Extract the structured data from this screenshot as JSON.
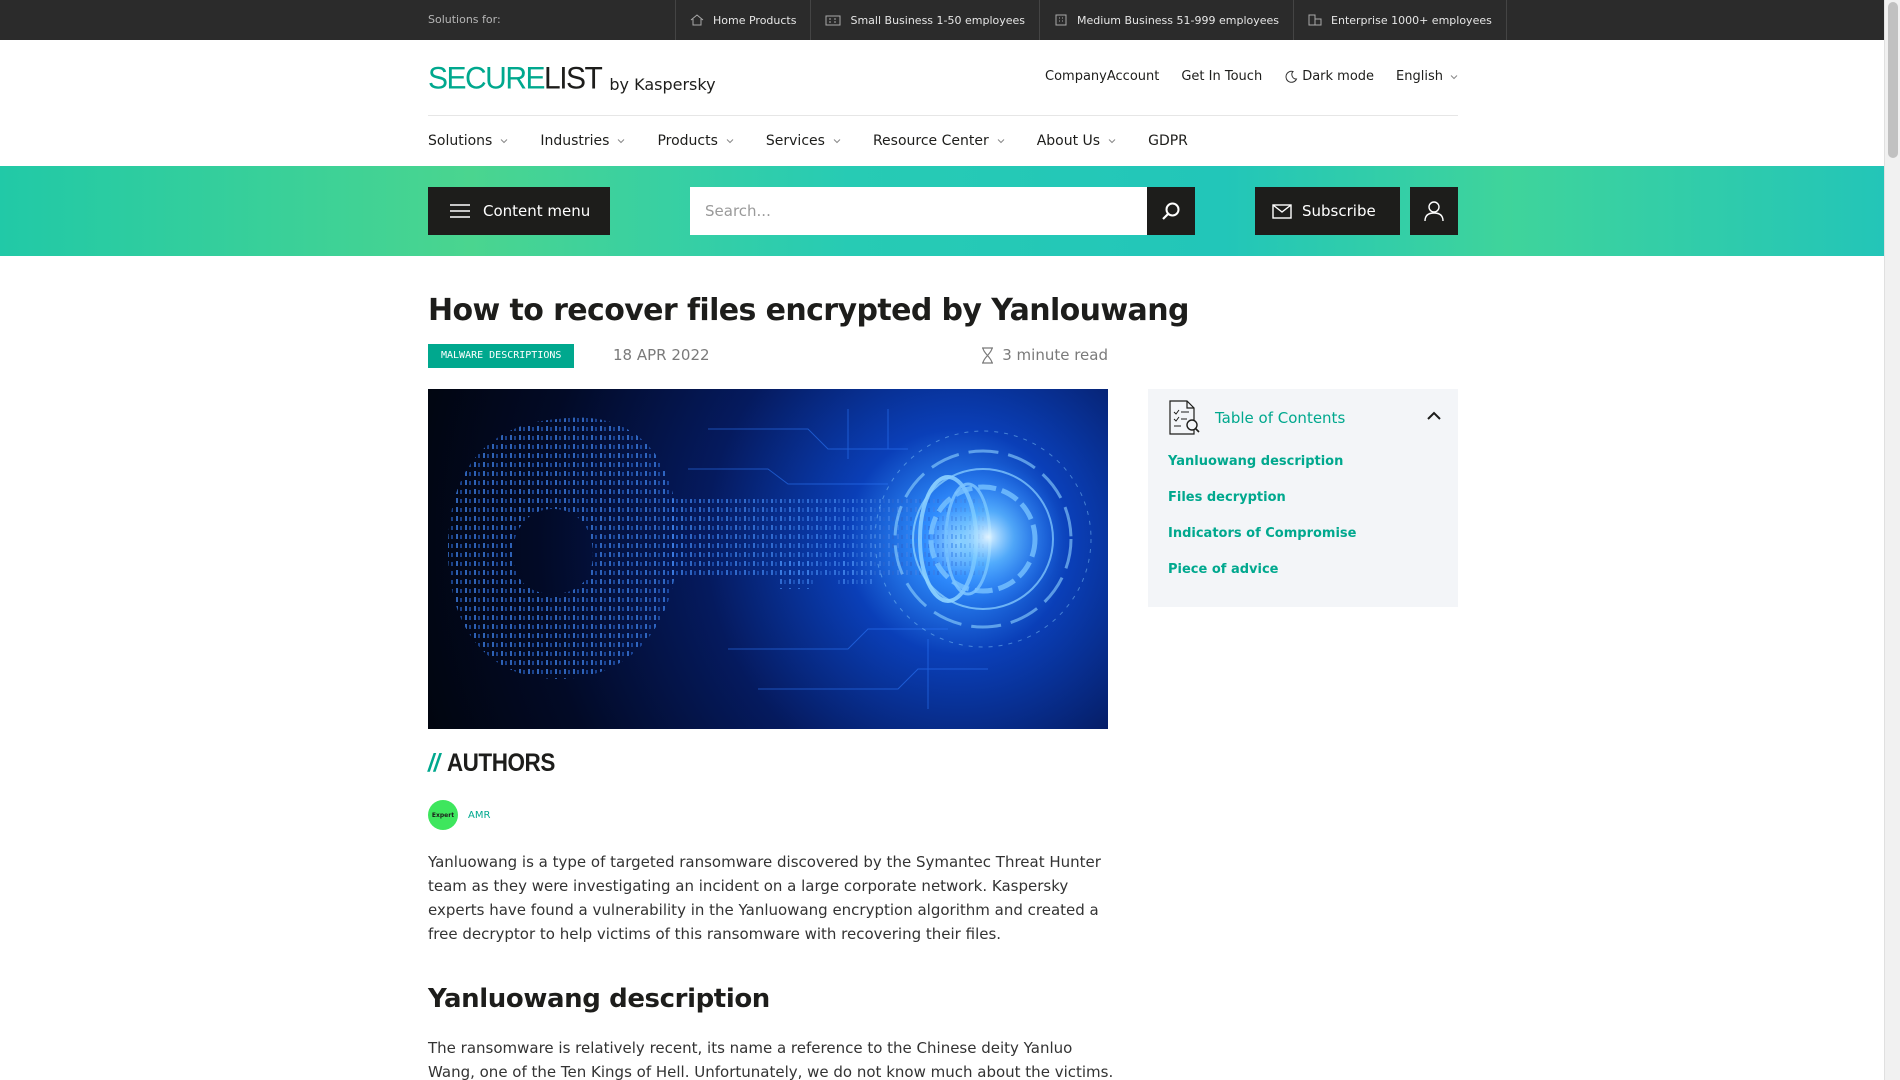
{
  "topbar": {
    "solutions_label": "Solutions for:",
    "segments": [
      {
        "label": "Home Products",
        "icon": "home-icon"
      },
      {
        "label": "Small Business 1-50 employees",
        "icon": "small-building-icon"
      },
      {
        "label": "Medium Business 51-999 employees",
        "icon": "medium-building-icon"
      },
      {
        "label": "Enterprise 1000+ employees",
        "icon": "enterprise-building-icon"
      }
    ]
  },
  "header": {
    "brand_part1": "SECURE",
    "brand_part2": "LIST",
    "by": "by Kaspersky",
    "links": {
      "company_account": "CompanyAccount",
      "get_in_touch": "Get In Touch",
      "dark_mode": "Dark mode",
      "language": "English"
    }
  },
  "nav": {
    "items": [
      "Solutions",
      "Industries",
      "Products",
      "Services",
      "Resource Center",
      "About Us",
      "GDPR"
    ]
  },
  "toolbar": {
    "content_menu": "Content menu",
    "search_placeholder": "Search...",
    "subscribe": "Subscribe"
  },
  "article": {
    "title": "How to recover files encrypted by Yanlouwang",
    "tag": "MALWARE DESCRIPTIONS",
    "date": "18 APR 2022",
    "read_time": "3 minute read",
    "authors_heading": "AUTHORS",
    "authors_slashes": "//",
    "author": {
      "badge": "Expert",
      "name": "AMR"
    },
    "intro": "Yanluowang is a type of targeted ransomware discovered by the Symantec Threat Hunter team as they were investigating an incident on a large corporate network. Kaspersky experts have found a vulnerability in the Yanluowang encryption algorithm and created a free decryptor to help victims of this ransomware with recovering their files.",
    "section_heading": "Yanluowang description",
    "section_text": "The ransomware is relatively recent, its name a reference to the Chinese deity Yanluo Wang, one of the Ten Kings of Hell. Unfortunately, we do not know much about the victims. According to"
  },
  "toc": {
    "title": "Table of Contents",
    "items": [
      "Yanluowang description",
      "Files decryption",
      "Indicators of Compromise",
      "Piece of advice"
    ]
  },
  "colors": {
    "accent": "#00a88e",
    "dark": "#1d1d1b",
    "topbar": "#2b2b2b"
  }
}
